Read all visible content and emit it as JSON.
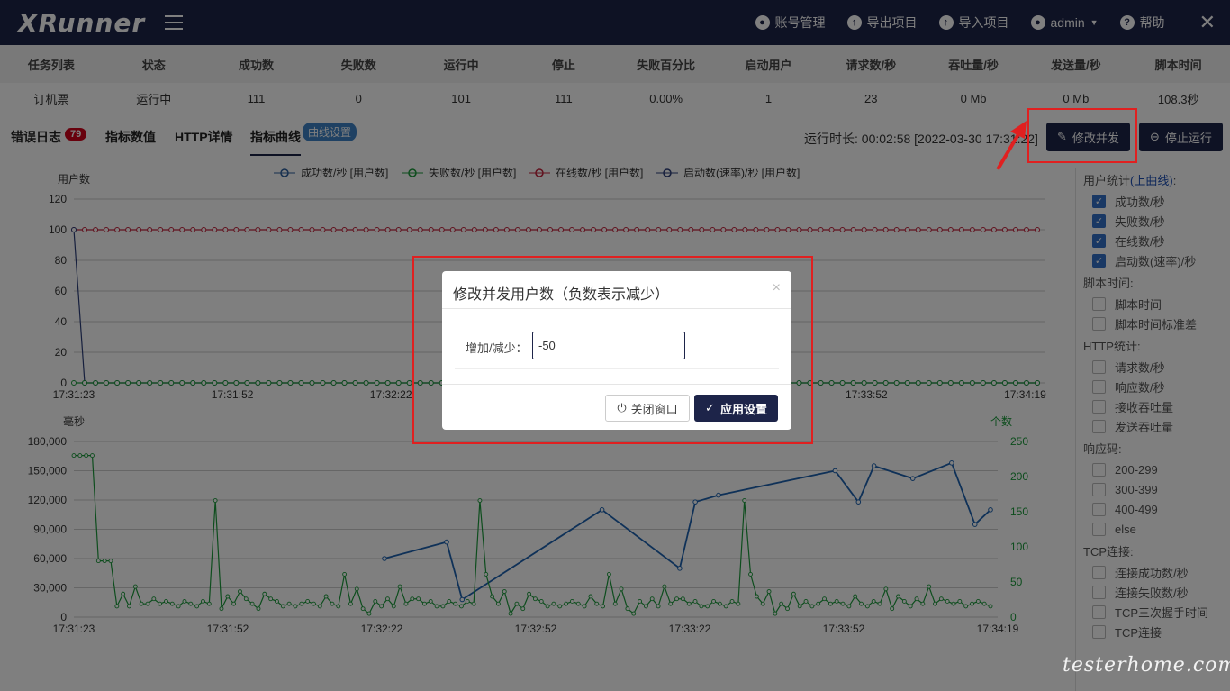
{
  "app": {
    "logo": "XRunner"
  },
  "header": {
    "items": [
      {
        "label": "账号管理",
        "icon": "user-icon"
      },
      {
        "label": "导出项目",
        "icon": "cloud-upload-icon"
      },
      {
        "label": "导入项目",
        "icon": "cloud-upload-icon"
      },
      {
        "label": "admin",
        "icon": "user-circle-icon"
      },
      {
        "label": "帮助",
        "icon": "help-icon"
      }
    ],
    "close": "✕"
  },
  "stats": {
    "headers": [
      "任务列表",
      "状态",
      "成功数",
      "失败数",
      "运行中",
      "停止",
      "失败百分比",
      "启动用户",
      "请求数/秒",
      "吞吐量/秒",
      "发送量/秒",
      "脚本时间"
    ],
    "values": [
      "订机票",
      "运行中",
      "111",
      "0",
      "101",
      "111",
      "0.00%",
      "1",
      "23",
      "0 Mb",
      "0 Mb",
      "108.3秒"
    ]
  },
  "tabs": {
    "error_log": "错误日志",
    "error_count": "79",
    "metric_values": "指标数值",
    "http_details": "HTTP详情",
    "metric_curve": "指标曲线",
    "curve_settings": "曲线设置"
  },
  "runtime": "运行时长: 00:02:58  [2022-03-30 17:31:22]",
  "buttons": {
    "modify_concurrency": "修改并发",
    "stop_run": "停止运行"
  },
  "chart_data": [
    {
      "type": "line",
      "ylabel": "用户数",
      "ylim": [
        0,
        120
      ],
      "yticks": [
        "0",
        "20",
        "40",
        "60",
        "80",
        "100",
        "120"
      ],
      "xticks": [
        "17:31:23",
        "17:31:52",
        "17:32:22",
        "17:32:52",
        "17:33:22",
        "17:33:52",
        "17:34:19"
      ],
      "legend": [
        "成功数/秒 [用户数]",
        "失败数/秒 [用户数]",
        "在线数/秒 [用户数]",
        "启动数(速率)/秒 [用户数]"
      ],
      "series": [
        {
          "name": "在线数/秒 [用户数]",
          "color": "#c2213a",
          "values": [
            100,
            100,
            100,
            100,
            100,
            100,
            100
          ]
        },
        {
          "name": "启动数(速率)/秒 [用户数]",
          "color": "#2c3e7a",
          "values": [
            100,
            0,
            0,
            0,
            0,
            0,
            0
          ]
        },
        {
          "name": "失败数/秒 [用户数]",
          "color": "#1a9a3a",
          "values": [
            0,
            0,
            0,
            0,
            0,
            0,
            0
          ]
        }
      ]
    },
    {
      "type": "line",
      "ylabel": "毫秒",
      "ylabel_right": "个数",
      "ylim": [
        0,
        180000
      ],
      "yticks": [
        "0",
        "30,000",
        "60,000",
        "90,000",
        "120,000",
        "150,000",
        "180,000"
      ],
      "yticks_right": [
        "0",
        "50",
        "100",
        "150",
        "200",
        "250"
      ],
      "xticks": [
        "17:31:23",
        "17:31:52",
        "17:32:22",
        "17:32:52",
        "17:33:22",
        "17:33:52",
        "17:34:19"
      ],
      "series": [
        {
          "name": "blue",
          "color": "#1e63b0",
          "x": [
            17.32,
            17.4,
            17.42,
            17.6,
            17.7,
            17.72,
            17.75,
            17.9,
            17.93,
            17.95,
            18.0,
            18.05,
            18.08,
            18.1
          ],
          "values": [
            60000,
            77000,
            18000,
            110000,
            50000,
            118000,
            125000,
            150000,
            118000,
            155000,
            142000,
            158000,
            95000,
            110000
          ]
        },
        {
          "name": "green",
          "color": "#1a9a3a",
          "values": [
            230,
            80,
            20,
            50,
            10,
            35,
            20,
            45,
            0,
            25,
            15,
            30,
            20,
            10,
            40,
            15,
            55,
            20,
            30,
            25,
            15,
            20,
            30,
            20,
            25,
            15,
            20,
            25,
            20,
            15,
            25,
            20,
            15,
            35,
            20,
            15,
            25,
            20
          ]
        }
      ]
    }
  ],
  "sidebar": {
    "user_stats": "用户统计",
    "upper_curve": "(上曲线)",
    "user_items": [
      "成功数/秒",
      "失败数/秒",
      "在线数/秒",
      "启动数(速率)/秒"
    ],
    "script_time": "脚本时间:",
    "script_items": [
      "脚本时间",
      "脚本时间标准差"
    ],
    "http_stats": "HTTP统计:",
    "http_items": [
      "请求数/秒",
      "响应数/秒",
      "接收吞吐量",
      "发送吞吐量"
    ],
    "resp_code": "响应码:",
    "resp_items": [
      "200-299",
      "300-399",
      "400-499",
      "else"
    ],
    "tcp": "TCP连接:",
    "tcp_items": [
      "连接成功数/秒",
      "连接失败数/秒",
      "TCP三次握手时间",
      "TCP连接"
    ]
  },
  "modal": {
    "title": "修改并发用户数（负数表示减少）",
    "label": "增加/减少：",
    "value": "-50",
    "close_button": "关闭窗口",
    "apply_button": "应用设置"
  },
  "watermark": "testerhome.com"
}
